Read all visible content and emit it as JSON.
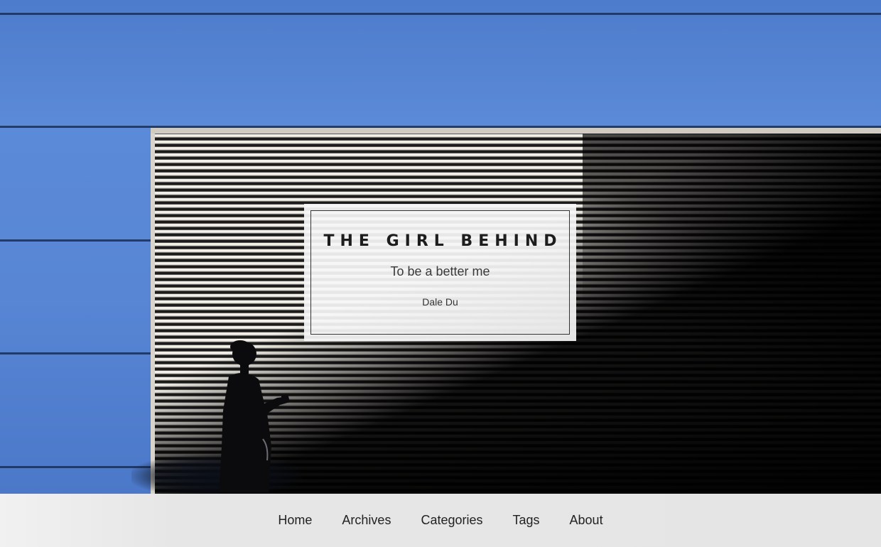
{
  "header": {
    "title": "THE GIRL BEHIND",
    "subtitle": "To be a better me",
    "author": "Dale Du"
  },
  "nav": {
    "items": [
      {
        "label": "Home"
      },
      {
        "label": "Archives"
      },
      {
        "label": "Categories"
      },
      {
        "label": "Tags"
      },
      {
        "label": "About"
      }
    ]
  },
  "colors": {
    "wall": "#5a87d4",
    "shutter_light": "#f2efe8",
    "shutter_dark": "#1c1c1c",
    "nav_background": "#e5e5e5",
    "text": "#1d1d1d"
  }
}
